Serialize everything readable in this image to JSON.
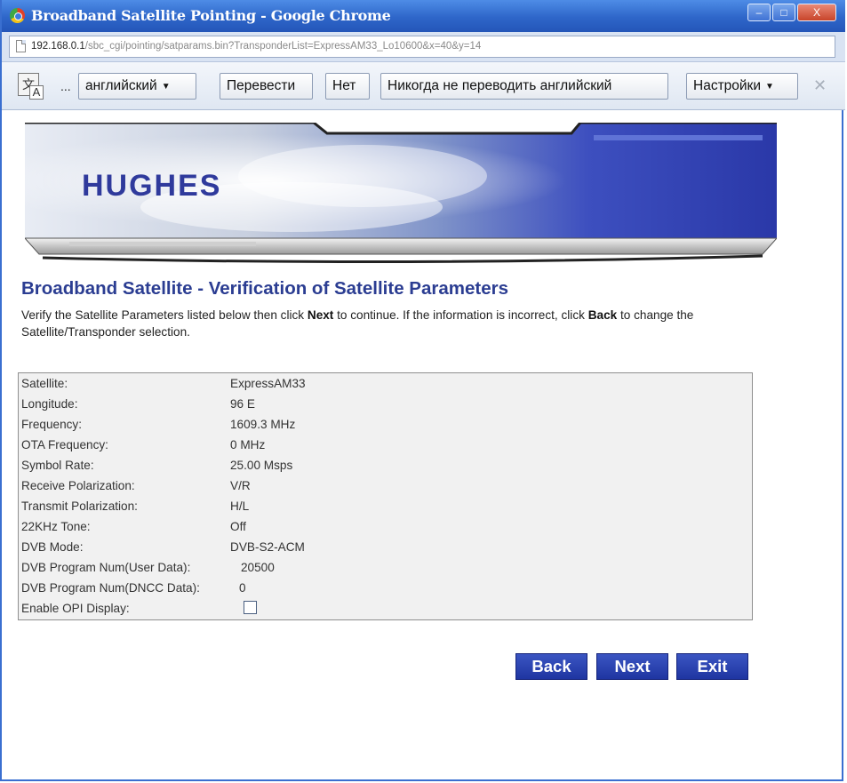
{
  "window": {
    "title": "Broadband Satellite Pointing - Google Chrome",
    "controls": {
      "minimize": "–",
      "maximize": "□",
      "close": "X"
    }
  },
  "address_bar": {
    "host": "192.168.0.1",
    "path": "/sbc_cgi/pointing/satparams.bin?TransponderList=ExpressAM33_Lo10600&x=40&y=14"
  },
  "translate_bar": {
    "icon_glyph": "文",
    "icon_letter": "A",
    "ellipsis": "...",
    "language_select": "английский",
    "translate_button": "Перевести",
    "no_button": "Нет",
    "never_translate_button": "Никогда не переводить английский",
    "settings_button": "Настройки",
    "close_glyph": "✕"
  },
  "banner": {
    "logo": "HUGHES"
  },
  "page": {
    "heading": "Broadband Satellite - Verification of Satellite Parameters",
    "intro_part1": "Verify the Satellite Parameters listed below then click ",
    "intro_next": "Next",
    "intro_part2": " to continue. If the information is incorrect, click ",
    "intro_back": "Back",
    "intro_part3": " to change the Satellite/Transponder selection."
  },
  "params": [
    {
      "label": "Satellite:",
      "value": "ExpressAM33"
    },
    {
      "label": "Longitude:",
      "value": "96  E"
    },
    {
      "label": "Frequency:",
      "value": "1609.3  MHz"
    },
    {
      "label": "OTA Frequency:",
      "value": "0  MHz"
    },
    {
      "label": "Symbol Rate:",
      "value": "25.00 Msps"
    },
    {
      "label": "Receive Polarization:",
      "value": "V/R"
    },
    {
      "label": "Transmit Polarization:",
      "value": "H/L"
    },
    {
      "label": "22KHz Tone:",
      "value": "Off"
    },
    {
      "label": "DVB Mode:",
      "value": "DVB-S2-ACM"
    },
    {
      "label": "DVB Program Num(User Data):",
      "value": "20500"
    },
    {
      "label": "DVB Program Num(DNCC Data):",
      "value": "0"
    },
    {
      "label": "Enable OPI Display:",
      "checked": false
    }
  ],
  "buttons": {
    "back": "Back",
    "next": "Next",
    "exit": "Exit"
  }
}
